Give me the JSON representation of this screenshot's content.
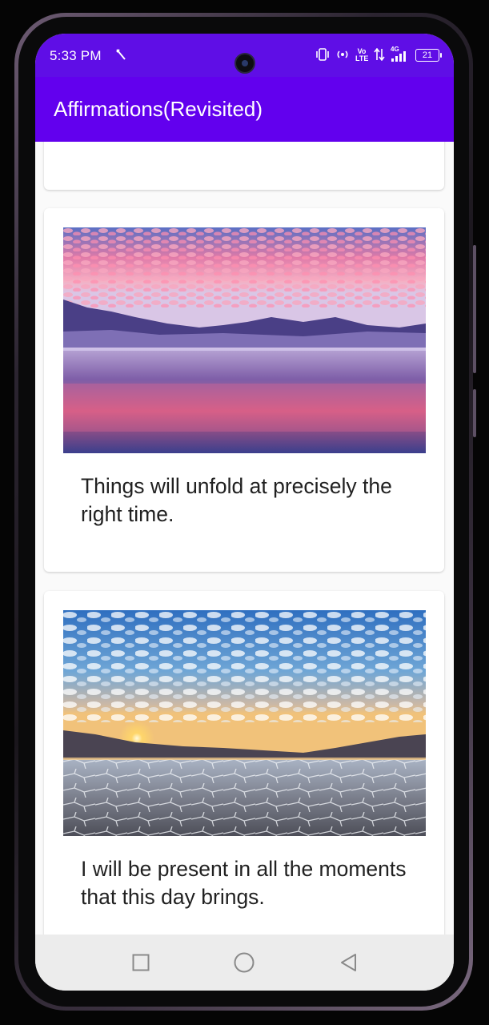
{
  "status_bar": {
    "time": "5:33 PM",
    "nav_indicator": "⋎",
    "icons": [
      "vibrate-icon",
      "hotspot-icon",
      "volte-icon",
      "data-arrows-icon",
      "signal-4g-icon",
      "battery-icon"
    ],
    "volte_label": "Vo LTE",
    "network_label": "4G",
    "battery_level": "21"
  },
  "app_bar": {
    "title": "Affirmations(Revisited)"
  },
  "cards": [
    {
      "image": "sunset-lake-mountains-image",
      "text": "Things will unfold at precisely the right time."
    },
    {
      "image": "sunset-salt-flats-image",
      "text": "I will be present in all the moments that this day brings."
    }
  ],
  "nav_bar": {
    "buttons": [
      "recent-apps-icon",
      "home-icon",
      "back-icon"
    ]
  },
  "colors": {
    "status_bar": "#5f0ee6",
    "app_bar": "#6200ee",
    "card_background": "#ffffff",
    "text": "#212121",
    "nav_bar": "#ececec"
  }
}
